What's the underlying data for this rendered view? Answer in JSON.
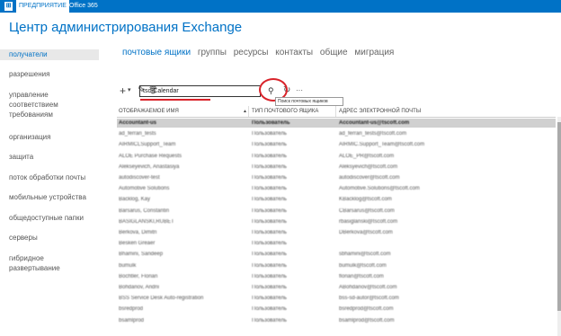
{
  "topbar": {
    "logo_glyph": "⊞",
    "tabs": [
      "ПРЕДПРИЯТИЕ",
      "Office 365"
    ]
  },
  "title": "Центр администрирования Exchange",
  "nav": [
    "получатели",
    "разрешения",
    "управление",
    "соответствием",
    "требованиям",
    "организация",
    "защита",
    "поток обработки почты",
    "мобильные устройства",
    "общедоступные папки",
    "серверы",
    "гибридное",
    "развертывание"
  ],
  "tabs": [
    "почтовые ящики",
    "группы",
    "ресурсы",
    "контакты",
    "общие",
    "миграция"
  ],
  "toolbar": {
    "add": "+",
    "dropdown": "▾",
    "edit": "✎",
    "delete": "🗑",
    "refresh": "↻",
    "more": "···",
    "search_btn": "⚲"
  },
  "search": {
    "value": "tsc-Calendar"
  },
  "tooltip": "Поиск почтовых ящиков",
  "columns": [
    "ОТОБРАЖАЕМОЕ ИМЯ",
    "ТИП ПОЧТОВОГО ЯЩИКА",
    "АДРЕС ЭЛЕКТРОННОЙ ПОЧТЫ"
  ],
  "sort_indicator": "▲",
  "rows": [
    [
      "Accountant-us",
      "Пользователь",
      "Accountant-us@tscoft.com"
    ],
    [
      "ad_ferrari_tests",
      "Пользователь",
      "ad_ferrari_tests@tscoft.com"
    ],
    [
      "AIRMICLSupport_Team",
      "Пользователь",
      "AIRMIC.Support_Team@tscoft.com"
    ],
    [
      "ALOE Purchase Requests",
      "Пользователь",
      "ALOE_PR@tscoft.com"
    ],
    [
      "Alekseyevich, Anastasiya",
      "Пользователь",
      "Aleksyevich@tscoft.com"
    ],
    [
      "autodiscover-test",
      "Пользователь",
      "autodiscover@tscoft.com"
    ],
    [
      "Automotive Solutions",
      "Пользователь",
      "Automotive.Solutions@tscoft.com"
    ],
    [
      "Backlog, Kay",
      "Пользователь",
      "KBacklog@tscoft.com"
    ],
    [
      "Barsarus, Constantin",
      "Пользователь",
      "CBarsarus@tscoft.com"
    ],
    [
      "BASIGLANSKI,RUBET",
      "Пользователь",
      "rbasiglanski@tscoft.com"
    ],
    [
      "Berkova, Dimitri",
      "Пользователь",
      "DBerkova@tscoft.com"
    ],
    [
      "Besken Greaer",
      "Пользователь",
      ""
    ],
    [
      "Bhamini, Sandeep",
      "Пользователь",
      "sbhamini@tscoft.com"
    ],
    [
      "bumulk",
      "Пользователь",
      "bumulk@tscoft.com"
    ],
    [
      "Bochtler, Florian",
      "Пользователь",
      "florian@tscoft.com"
    ],
    [
      "Bohdanov, Andrii",
      "Пользователь",
      "ABohdanov@tscoft.com"
    ],
    [
      "BSS Service Desk Auto-registration",
      "Пользователь",
      "bss-sd-autor@tscoft.com"
    ],
    [
      "bsredprod",
      "Пользователь",
      "bsredprod@tscoft.com"
    ],
    [
      "bsamlprod",
      "Пользователь",
      "bsamlprod@tscoft.com"
    ]
  ]
}
